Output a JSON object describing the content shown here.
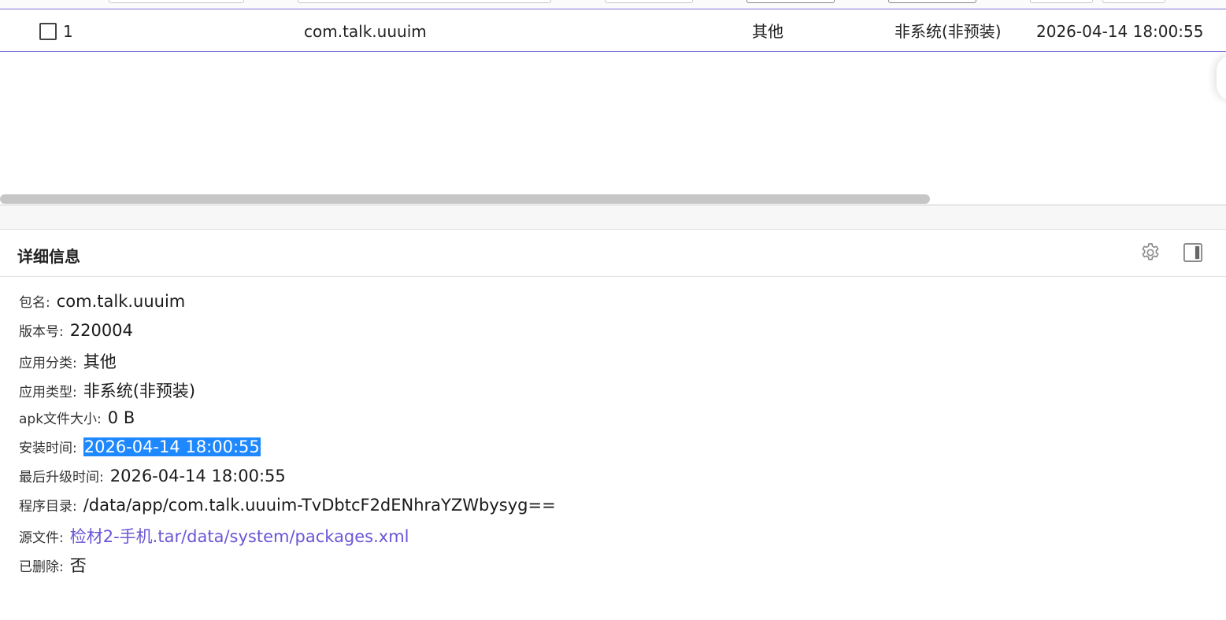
{
  "table": {
    "row": {
      "index": "1",
      "package": "com.talk.uuuim",
      "category": "其他",
      "app_type": "非系统(非预装)",
      "install_time": "2026-04-14 18:00:55"
    }
  },
  "detail": {
    "title": "详细信息",
    "fields": [
      {
        "label": "包名:",
        "value": "com.talk.uuuim"
      },
      {
        "label": "版本号:",
        "value": "220004"
      },
      {
        "label": "应用分类:",
        "value": "其他"
      },
      {
        "label": "应用类型:",
        "value": "非系统(非预装)"
      },
      {
        "label": "apk文件大小:",
        "value": "0 B"
      },
      {
        "label": "安装时间:",
        "value": "2026-04-14 18:00:55"
      },
      {
        "label": "最后升级时间:",
        "value": "2026-04-14 18:00:55"
      },
      {
        "label": "程序目录:",
        "value": "/data/app/com.talk.uuuim-TvDbtcF2dENhraYZWbysyg=="
      },
      {
        "label": "源文件:",
        "value": "检材2-手机.tar/data/system/packages.xml"
      },
      {
        "label": "已删除:",
        "value": "否"
      }
    ]
  },
  "icons": {
    "settings": "gear-icon",
    "panel": "panel-toggle-icon"
  },
  "colors": {
    "accent_line": "#7c74d6",
    "link": "#6a56d6",
    "selection": "#1e88ff"
  }
}
